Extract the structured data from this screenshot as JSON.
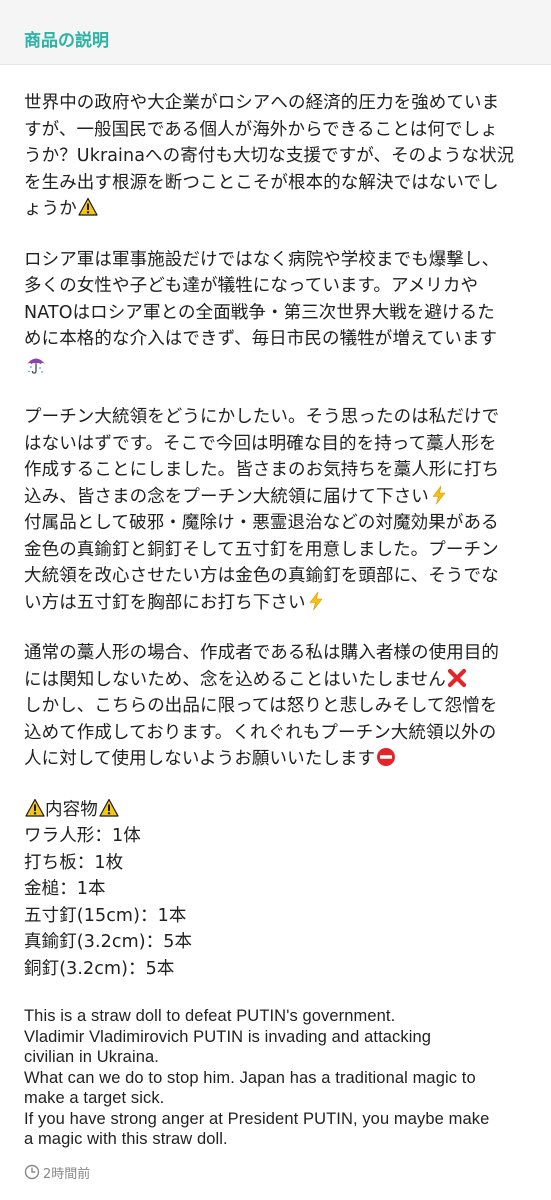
{
  "header": {
    "title": "商品の説明"
  },
  "description": {
    "p1": [
      "世界中の政府や大企業がロシアへの経済的圧力を強めていま",
      "すが、一般国民である個人が海外からできることは何でしょ",
      "うか？Ukrainaへの寄付も大切な支援ですが、そのような状況",
      "を生み出す根源を断つことこそが根本的な解決ではないでし",
      "ょうか"
    ],
    "p2": [
      "ロシア軍は軍事施設だけではなく病院や学校までも爆撃し、",
      "多くの女性や子ども達が犠牲になっています。アメリカや",
      "NATOはロシア軍との全面戦争・第三次世界大戦を避けるた",
      "めに本格的な介入はできず、毎日市民の犠牲が増えています"
    ],
    "p3": [
      "プーチン大統領をどうにかしたい。そう思ったのは私だけで",
      "はないはずです。そこで今回は明確な目的を持って藁人形を",
      "作成することにしました。皆さまのお気持ちを藁人形に打ち",
      "込み、皆さまの念をプーチン大統領に届けて下さい",
      "付属品として破邪・魔除け・悪霊退治などの対魔効果がある",
      "金色の真鍮釘と銅釘そして五寸釘を用意しました。プーチン",
      "大統領を改心させたい方は金色の真鍮釘を頭部に、そうでな",
      "い方は五寸釘を胸部にお打ち下さい"
    ],
    "p4": [
      "通常の藁人形の場合、作成者である私は購入者様の使用目的",
      "には関知しないため、念を込めることはいたしません",
      "しかし、こちらの出品に限っては怒りと悲しみそして怨憎を",
      "込めて作成しております。くれぐれもプーチン大統領以外の",
      "人に対して使用しないようお願いいたします"
    ],
    "contents": {
      "heading": "内容物",
      "items": [
        "ワラ人形：1体",
        "打ち板：1枚",
        "金槌：1本",
        "五寸釘(15cm)：1本",
        "真鍮釘(3.2cm)：5本",
        "銅釘(3.2cm)：5本"
      ]
    },
    "english": [
      "This is a straw doll to defeat PUTIN's government.",
      "Vladimir Vladimirovich PUTIN is invading and attacking",
      "civilian in Ukraina.",
      "What can we do to stop him. Japan has a traditional magic to",
      "make a target sick.",
      "If you have strong anger at President PUTIN, you maybe make",
      "a magic with this straw doll."
    ]
  },
  "icons": {
    "warning": "warning-icon",
    "umbrella": "umbrella-icon",
    "lightning": "lightning-icon",
    "cross": "cross-mark-icon",
    "no_entry": "no-entry-icon",
    "clock": "clock-icon"
  },
  "footer": {
    "timestamp": "2時間前"
  },
  "colors": {
    "accent": "#2bb3a5",
    "header_bg": "#f4f5f4",
    "text": "#212121",
    "muted": "#888888"
  }
}
